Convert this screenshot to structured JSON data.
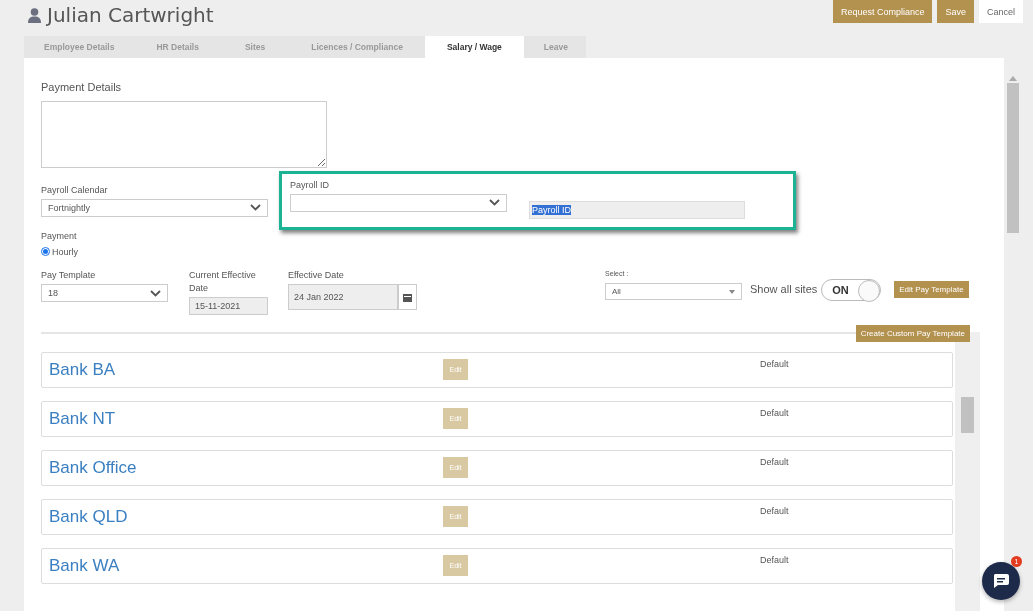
{
  "header": {
    "title": "Julian Cartwright",
    "buttons": [
      {
        "label": "Request Compliance",
        "kind": "primary"
      },
      {
        "label": "Save",
        "kind": "primary"
      },
      {
        "label": "Cancel",
        "kind": "plain"
      }
    ]
  },
  "tabs": [
    {
      "label": "Employee Details",
      "selected": false
    },
    {
      "label": "HR Details",
      "selected": false
    },
    {
      "label": "Sites",
      "selected": false
    },
    {
      "label": "Licences / Compliance",
      "selected": false
    },
    {
      "label": "Salary / Wage",
      "selected": true
    },
    {
      "label": "Leave",
      "selected": false
    }
  ],
  "payment_details": {
    "label": "Payment Details"
  },
  "payroll_calendar": {
    "label": "Payroll Calendar",
    "value": "Fortnightly"
  },
  "payroll_id": {
    "label": "Payroll ID",
    "highlighted": true,
    "input_value": "Payroll ID",
    "text_selected": true
  },
  "payment": {
    "label": "Payment",
    "options": [
      {
        "label": "Hourly",
        "selected": true
      }
    ]
  },
  "pay_template": {
    "label": "Pay Template",
    "value": "18"
  },
  "current_effective_date": {
    "label": "Current Effective Date",
    "value": "15-11-2021"
  },
  "effective_date": {
    "label": "Effective Date",
    "value": "24 Jan 2022"
  },
  "site_select": {
    "label": "Select :",
    "value": "All"
  },
  "show_all_sites": {
    "label": "Show all sites",
    "on": true,
    "state_label": "ON"
  },
  "edit_pay_template": {
    "label": "Edit Pay Template"
  },
  "create_custom_pay_template": {
    "label": "Create Custom Pay Template"
  },
  "templates": [
    {
      "name": "Bank BA",
      "edit": "Edit",
      "status": "Default"
    },
    {
      "name": "Bank NT",
      "edit": "Edit",
      "status": "Default"
    },
    {
      "name": "Bank Office",
      "edit": "Edit",
      "status": "Default"
    },
    {
      "name": "Bank QLD",
      "edit": "Edit",
      "status": "Default"
    },
    {
      "name": "Bank WA",
      "edit": "Edit",
      "status": "Default"
    }
  ],
  "chat": {
    "badge": "1"
  }
}
